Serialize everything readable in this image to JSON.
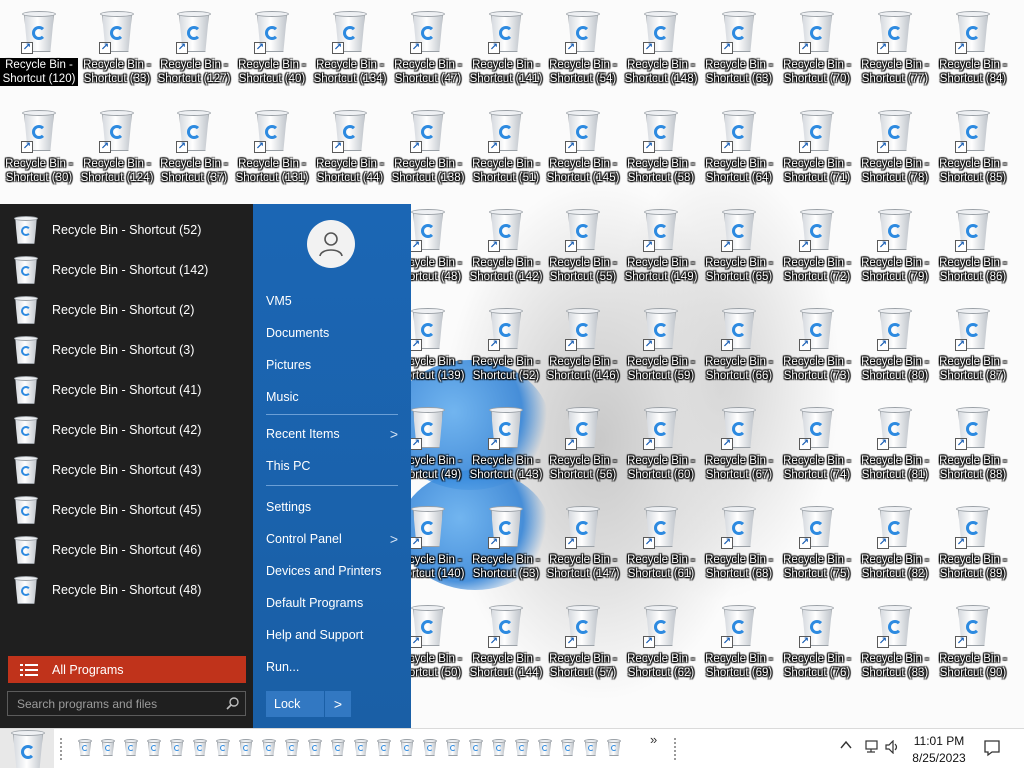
{
  "desktop": {
    "selected_icon": "Recycle Bin - Shortcut (120)",
    "columns": [
      [
        "Recycle Bin - Shortcut (120)",
        "Recycle Bin - Shortcut (30)"
      ],
      [
        "Recycle Bin - Shortcut (33)",
        "Recycle Bin - Shortcut (124)"
      ],
      [
        "Recycle Bin - Shortcut (127)",
        "Recycle Bin - Shortcut (37)"
      ],
      [
        "Recycle Bin - Shortcut (40)",
        "Recycle Bin - Shortcut (131)"
      ],
      [
        "Recycle Bin - Shortcut (134)",
        "Recycle Bin - Shortcut (44)"
      ],
      [
        "Recycle Bin - Shortcut (47)",
        "Recycle Bin - Shortcut (138)",
        "Recycle Bin - Shortcut (48)",
        "Recycle Bin - Shortcut (139)",
        "Recycle Bin - Shortcut (49)",
        "Recycle Bin - Shortcut (140)",
        "Recycle Bin - Shortcut (50)"
      ],
      [
        "Recycle Bin - Shortcut (141)",
        "Recycle Bin - Shortcut (51)",
        "Recycle Bin - Shortcut (142)",
        "Recycle Bin - Shortcut (52)",
        "Recycle Bin - Shortcut (143)",
        "Recycle Bin - Shortcut (53)",
        "Recycle Bin - Shortcut (144)"
      ],
      [
        "Recycle Bin - Shortcut (54)",
        "Recycle Bin - Shortcut (145)",
        "Recycle Bin - Shortcut (55)",
        "Recycle Bin - Shortcut (146)",
        "Recycle Bin - Shortcut (56)",
        "Recycle Bin - Shortcut (147)",
        "Recycle Bin - Shortcut (57)"
      ],
      [
        "Recycle Bin - Shortcut (148)",
        "Recycle Bin - Shortcut (58)",
        "Recycle Bin - Shortcut (149)",
        "Recycle Bin - Shortcut (59)",
        "Recycle Bin - Shortcut (60)",
        "Recycle Bin - Shortcut (61)",
        "Recycle Bin - Shortcut (62)"
      ],
      [
        "Recycle Bin - Shortcut (63)",
        "Recycle Bin - Shortcut (64)",
        "Recycle Bin - Shortcut (65)",
        "Recycle Bin - Shortcut (66)",
        "Recycle Bin - Shortcut (67)",
        "Recycle Bin - Shortcut (68)",
        "Recycle Bin - Shortcut (69)"
      ],
      [
        "Recycle Bin - Shortcut (70)",
        "Recycle Bin - Shortcut (71)",
        "Recycle Bin - Shortcut (72)",
        "Recycle Bin - Shortcut (73)",
        "Recycle Bin - Shortcut (74)",
        "Recycle Bin - Shortcut (75)",
        "Recycle Bin - Shortcut (76)"
      ],
      [
        "Recycle Bin - Shortcut (77)",
        "Recycle Bin - Shortcut (78)",
        "Recycle Bin - Shortcut (79)",
        "Recycle Bin - Shortcut (80)",
        "Recycle Bin - Shortcut (81)",
        "Recycle Bin - Shortcut (82)",
        "Recycle Bin - Shortcut (83)"
      ],
      [
        "Recycle Bin - Shortcut (84)",
        "Recycle Bin - Shortcut (85)",
        "Recycle Bin - Shortcut (86)",
        "Recycle Bin - Shortcut (87)",
        "Recycle Bin - Shortcut (88)",
        "Recycle Bin - Shortcut (89)",
        "Recycle Bin - Shortcut (90)"
      ]
    ]
  },
  "start_menu": {
    "programs": [
      "Recycle Bin - Shortcut (52)",
      "Recycle Bin - Shortcut (142)",
      "Recycle Bin - Shortcut (2)",
      "Recycle Bin - Shortcut (3)",
      "Recycle Bin - Shortcut (41)",
      "Recycle Bin - Shortcut (42)",
      "Recycle Bin - Shortcut (43)",
      "Recycle Bin - Shortcut (45)",
      "Recycle Bin - Shortcut (46)",
      "Recycle Bin - Shortcut (48)"
    ],
    "all_programs_label": "All Programs",
    "search_placeholder": "Search programs and files",
    "places": {
      "user": "VM5",
      "documents": "Documents",
      "pictures": "Pictures",
      "music": "Music",
      "recent_items": "Recent Items",
      "this_pc": "This PC",
      "settings": "Settings",
      "control_panel": "Control Panel",
      "devices_printers": "Devices and Printers",
      "default_programs": "Default Programs",
      "help_support": "Help and Support",
      "run": "Run..."
    },
    "lock_label": "Lock",
    "lock_arrow": ">",
    "submenu_chevron": ">"
  },
  "taskbar": {
    "pinned_count": 24,
    "overflow": "»",
    "clock_time": "11:01 PM",
    "clock_date": "8/25/2023",
    "tray_up": "^",
    "icon_names": [
      "recycle-bin-icon",
      "network-icon",
      "volume-icon",
      "notification-icon"
    ]
  },
  "colors": {
    "start_left_bg": "#1f1f1f",
    "start_right_bg": "#1a5fa6",
    "all_programs_bg": "#c0331b",
    "taskbar_bg": "#ffffff"
  }
}
